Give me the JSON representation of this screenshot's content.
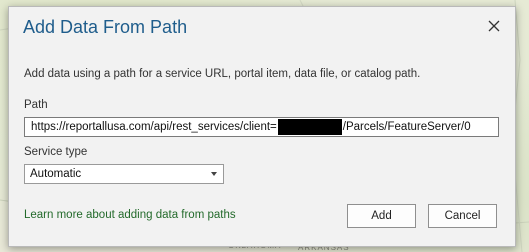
{
  "background": {
    "map_labels": [
      "OKLAHOMA",
      "ARKANSAS"
    ]
  },
  "dialog": {
    "title": "Add Data From Path",
    "close_icon": "close-icon",
    "description": "Add data using a path for a service URL, portal item, data file, or catalog path.",
    "path": {
      "label": "Path",
      "value_prefix": "https://reportallusa.com/api/rest_services/client=",
      "value_suffix": "/Parcels/FeatureServer/0"
    },
    "service_type": {
      "label": "Service type",
      "selected": "Automatic"
    },
    "learn_more_link": "Learn more about adding data from paths",
    "add_button": "Add",
    "cancel_button": "Cancel"
  },
  "colors": {
    "title": "#1f5d8c",
    "link": "#236a2b",
    "dialog_bg": "#f2f2f2"
  }
}
